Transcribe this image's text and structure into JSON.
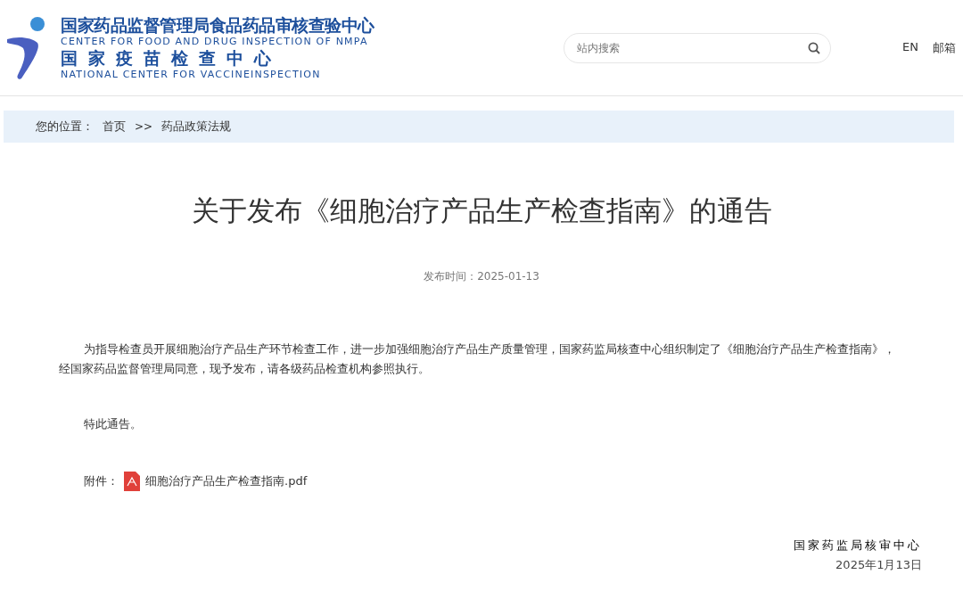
{
  "header": {
    "logo": {
      "title_cn": "国家药品监督管理局食品药品审核查验中心",
      "title_en": "CENTER FOR FOOD AND DRUG INSPECTION OF NMPA",
      "subtitle_cn": "国家疫苗检查中心",
      "subtitle_en": "NATIONAL CENTER FOR VACCINEINSPECTION"
    },
    "search": {
      "placeholder": "站内搜索"
    },
    "links": [
      "EN",
      "邮箱"
    ]
  },
  "breadcrumb": {
    "label": "您的位置：",
    "items": [
      {
        "text": "首页",
        "kind": "link"
      },
      {
        "text": ">>",
        "kind": "separator"
      },
      {
        "text": "药品政策法规",
        "kind": "link"
      }
    ]
  },
  "article": {
    "title": "关于发布《细胞治疗产品生产检查指南》的通告",
    "publish_time": "发布时间：2025-01-13",
    "paragraphs": [
      "为指导检查员开展细胞治疗产品生产环节检查工作，进一步加强细胞治疗产品生产质量管理，国家药监局核查中心组织制定了《细胞治疗产品生产检查指南》，经国家药品监督管理局同意，现予发布，请各级药品检查机构参照执行。",
      "特此通告。"
    ],
    "attachment": {
      "label": "附件：",
      "file": "细胞治疗产品生产检查指南.pdf"
    },
    "signature": {
      "org": "国家药监局核审中心",
      "date": "2025年1月13日"
    }
  }
}
